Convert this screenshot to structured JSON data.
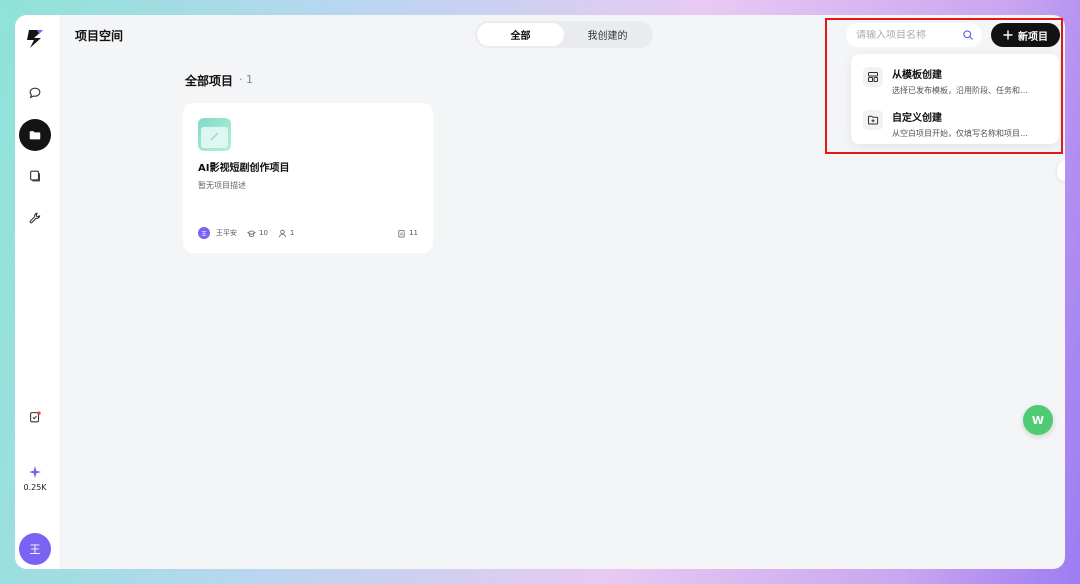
{
  "header": {
    "title": "项目空间",
    "tabs": [
      {
        "label": "全部",
        "active": true
      },
      {
        "label": "我创建的",
        "active": false
      }
    ],
    "search": {
      "placeholder": "请输入项目名称"
    },
    "new_button": {
      "label": "新项目"
    }
  },
  "dropdown": {
    "items": [
      {
        "title": "从模板创建",
        "desc": "选择已发布模板，沿用阶段、任务和…"
      },
      {
        "title": "自定义创建",
        "desc": "从空白项目开始，仅填写名称和项目…"
      }
    ]
  },
  "sidebar": {
    "items": [
      {
        "name": "chat",
        "active": false
      },
      {
        "name": "folder",
        "active": true
      },
      {
        "name": "library",
        "active": false
      },
      {
        "name": "tools",
        "active": false
      }
    ],
    "credits": "0.25K",
    "avatar": "王"
  },
  "main": {
    "section_title": "全部项目",
    "section_count": "· 1",
    "projects": [
      {
        "title": "AI影视短剧创作项目",
        "desc": "暂无项目描述",
        "owner": "王平安",
        "owner_initial": "王",
        "views": "10",
        "members": "1",
        "tasks": "11"
      }
    ]
  },
  "floating_button": {
    "label": "W"
  },
  "colors": {
    "accent": "#7b62f2",
    "primary_button": "#121212",
    "floating": "#4ecb73",
    "highlight": "#e01818"
  }
}
